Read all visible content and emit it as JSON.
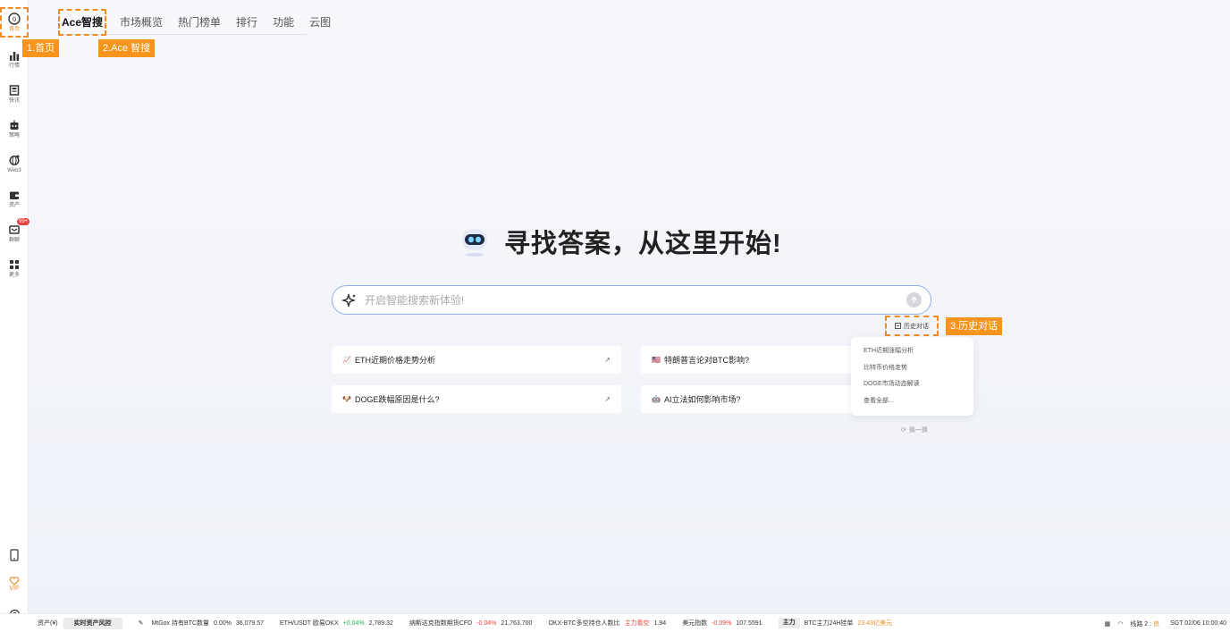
{
  "sidebar": {
    "items": [
      {
        "label": "首页",
        "icon": "home-icon"
      },
      {
        "label": "行情",
        "icon": "bar-chart-icon"
      },
      {
        "label": "快讯",
        "icon": "news-icon"
      },
      {
        "label": "策略",
        "icon": "robot-icon"
      },
      {
        "label": "Web3",
        "icon": "globe-icon"
      },
      {
        "label": "资产",
        "icon": "wallet-icon"
      },
      {
        "label": "群聊",
        "icon": "chat-icon",
        "badge": "99+"
      },
      {
        "label": "更多",
        "icon": "grid-icon"
      }
    ],
    "vip_label": "VIP"
  },
  "annotations": {
    "home": "1.首页",
    "ace": "2.Ace 智搜",
    "history": "3.历史对话"
  },
  "topnav": {
    "tabs": [
      "Ace智搜",
      "市场概览",
      "热门榜单",
      "排行",
      "功能",
      "云图"
    ]
  },
  "hero": {
    "title": "寻找答案，从这里开始!"
  },
  "search": {
    "placeholder": "开启智能搜索新体验!",
    "value": ""
  },
  "history_link": "历史对话",
  "suggestions": [
    {
      "emoji": "📈",
      "text": "ETH近期价格走势分析",
      "arrow": "↗"
    },
    {
      "emoji": "🇺🇸",
      "text": "特朗普言论对BTC影响?",
      "arrow": ""
    },
    {
      "emoji": "🐶",
      "text": "DOGE跌幅原因是什么?",
      "arrow": "↗"
    },
    {
      "emoji": "🤖",
      "text": "AI立法如何影响市场?",
      "arrow": ""
    }
  ],
  "history_dropdown": {
    "items": [
      "ETH近期涨幅分析",
      "比特币价格走势",
      "DOGE市场动态解读",
      "查看全部..."
    ]
  },
  "refresh_label": "换一换",
  "statusbar": {
    "asset_label": "资产(¥)",
    "risk_button": "实时资产风控",
    "mtgox_label": "MtGox 持有BTC数量",
    "mtgox_pct": "0.00%",
    "mtgox_val": "36,079.57",
    "eth_label": "ETH/USDT 欧易OKX",
    "eth_pct": "+0.04%",
    "eth_val": "2,789.32",
    "nasdaq_label": "纳斯达克指数期货CFD",
    "nasdaq_pct": "-0.04%",
    "nasdaq_val": "21,763.700",
    "okx_label": "OKX-BTC多空持仓人数比",
    "okx_tag": "主力看空",
    "okx_val": "1.94",
    "usd_label": "美元指数",
    "usd_pct": "-0.09%",
    "usd_val": "107.5591",
    "main_tag": "主力",
    "btc_label": "BTC主力24H挂单",
    "btc_val": "23.43亿美元",
    "line_label": "线路 2 :",
    "line_status": "良",
    "time": "SGT 02/06 10:00:40"
  },
  "colors": {
    "accent": "#f08c28",
    "up": "#1fb356",
    "down": "#e9433f",
    "search_border": "#8fb0ea"
  }
}
